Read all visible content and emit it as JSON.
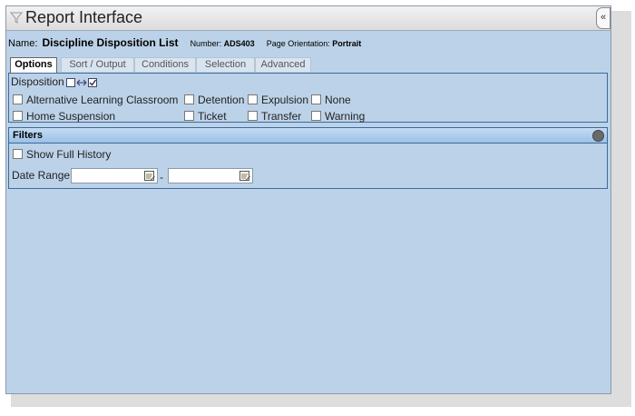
{
  "window": {
    "title": "Report Interface",
    "collapse_label": "«"
  },
  "report": {
    "name_label": "Name:",
    "name": "Discipline Disposition List",
    "number_label": "Number:",
    "number": "ADS403",
    "orientation_label": "Page Orientation:",
    "orientation": "Portrait"
  },
  "tabs": [
    {
      "label": "Options"
    },
    {
      "label": "Sort / Output"
    },
    {
      "label": "Conditions"
    },
    {
      "label": "Selection"
    },
    {
      "label": "Advanced"
    }
  ],
  "disposition": {
    "label": "Disposition",
    "options": [
      "Alternative Learning Classroom",
      "Detention",
      "Expulsion",
      "None",
      "Home Suspension",
      "Ticket",
      "Transfer",
      "Warning"
    ]
  },
  "filters": {
    "title": "Filters",
    "show_full_history": "Show Full History",
    "date_range_label": "Date Range",
    "date_separator": "-",
    "date_from": "",
    "date_to": ""
  }
}
